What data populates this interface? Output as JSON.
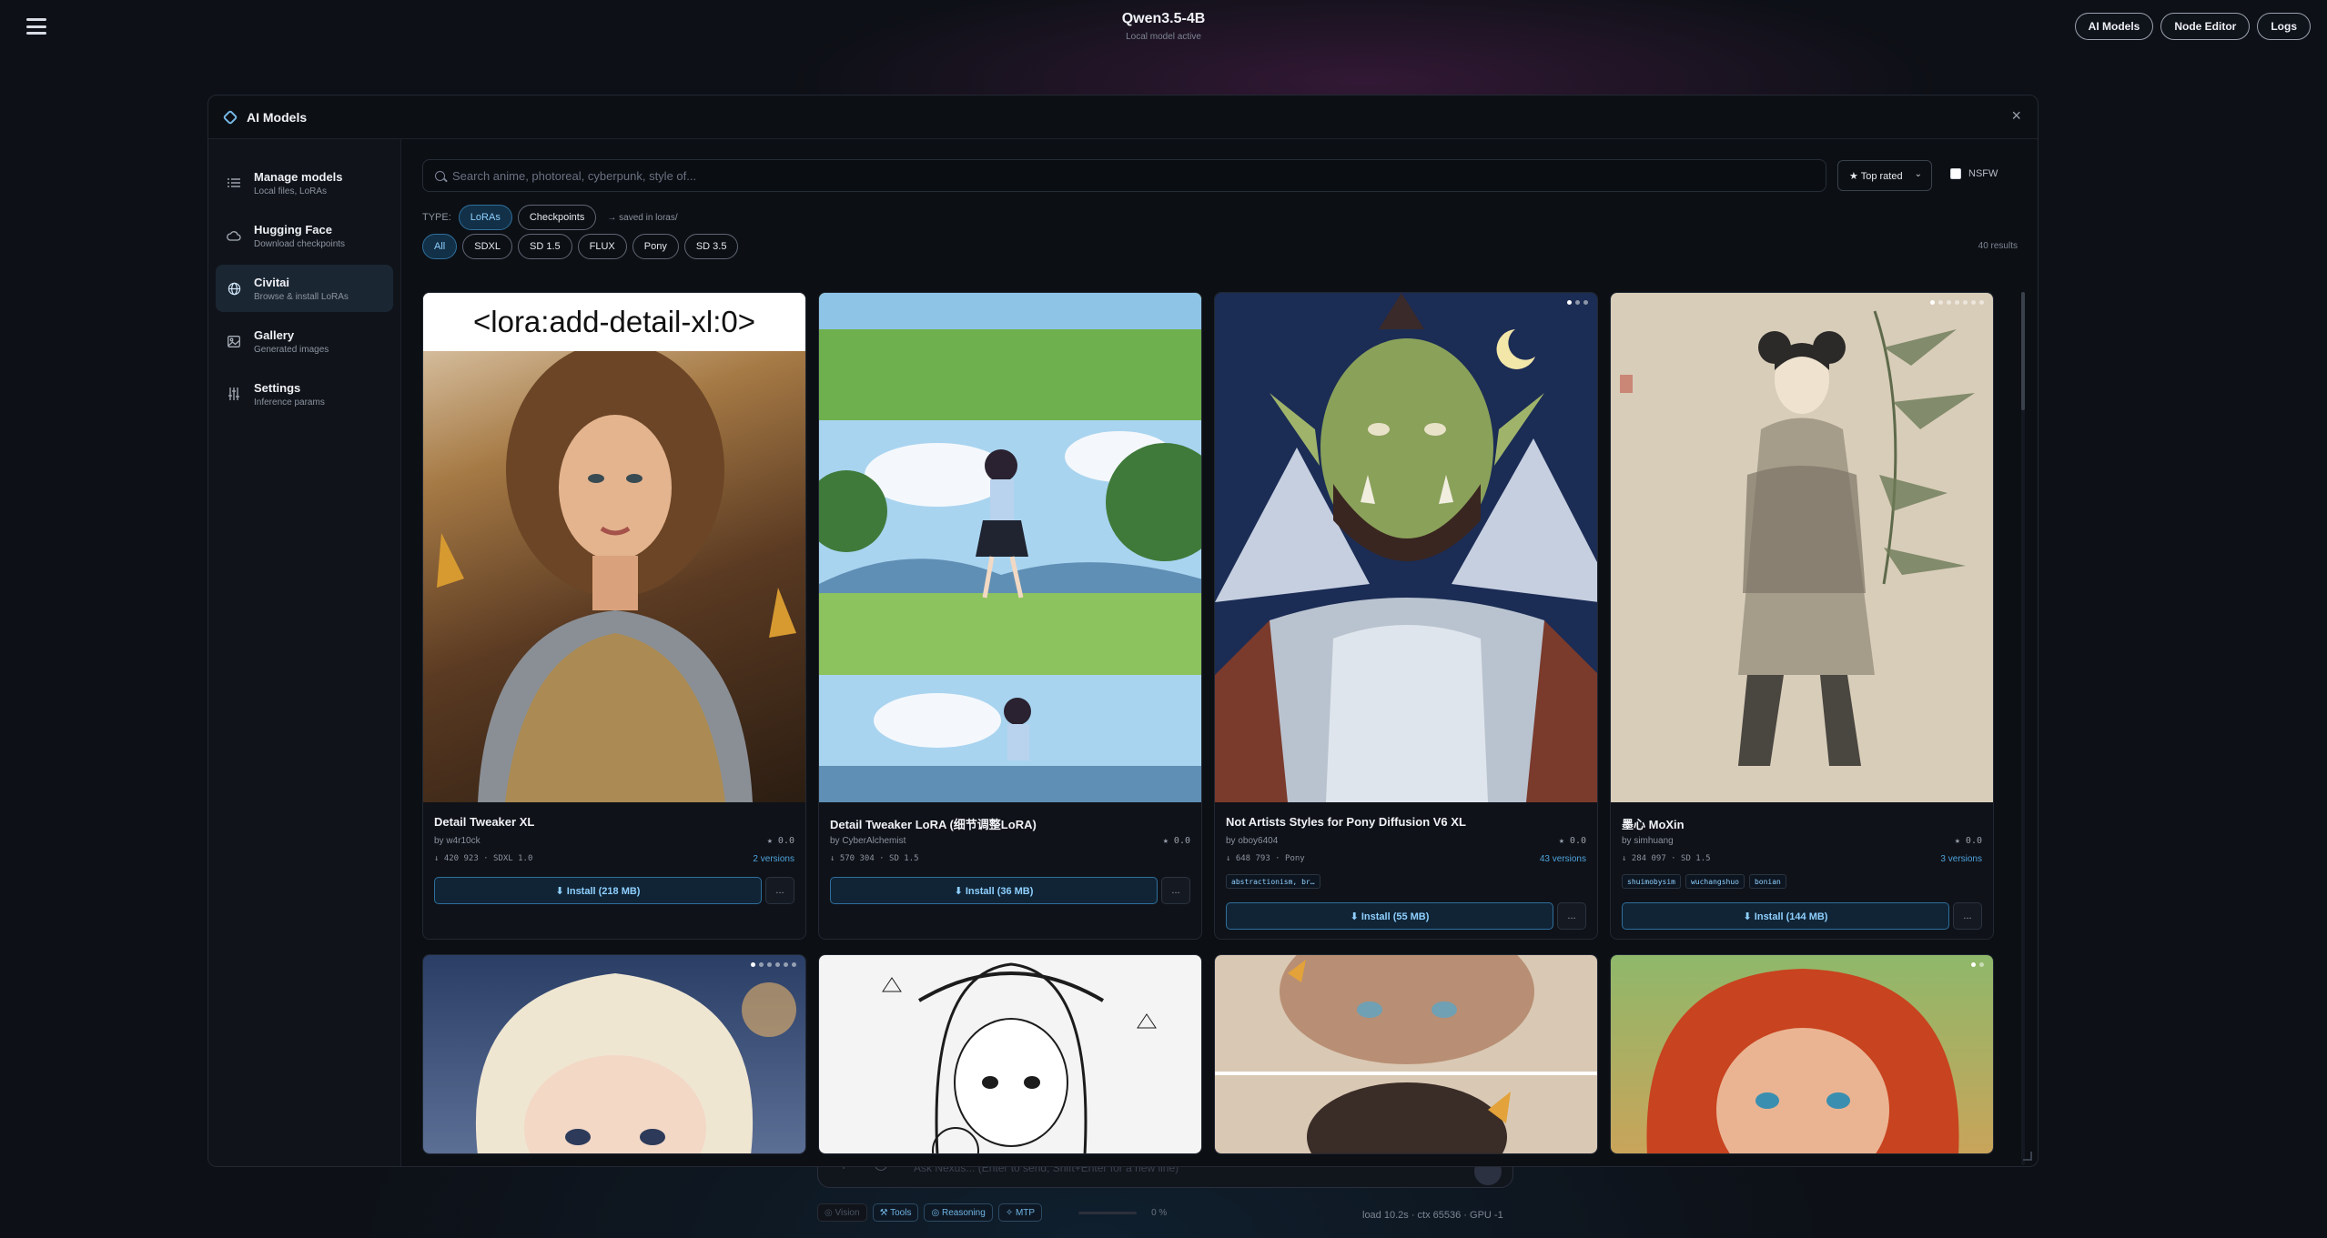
{
  "app": {
    "title": "Qwen3.5-4B",
    "subtitle": "Local model active"
  },
  "topnav": {
    "ai_models": "AI Models",
    "node_editor": "Node Editor",
    "logs": "Logs"
  },
  "modal": {
    "title": "AI Models",
    "close": "×"
  },
  "sidebar": {
    "items": [
      {
        "label": "Manage models",
        "sub": "Local files, LoRAs",
        "icon": "list-icon"
      },
      {
        "label": "Hugging Face",
        "sub": "Download checkpoints",
        "icon": "cloud-icon"
      },
      {
        "label": "Civitai",
        "sub": "Browse & install LoRAs",
        "icon": "globe-icon"
      },
      {
        "label": "Gallery",
        "sub": "Generated images",
        "icon": "image-icon"
      },
      {
        "label": "Settings",
        "sub": "Inference params",
        "icon": "sliders-icon"
      }
    ],
    "active": "Civitai"
  },
  "search": {
    "placeholder": "Search anime, photoreal, cyberpunk, style of..."
  },
  "sort": {
    "selected": "★ Top rated"
  },
  "nsfw": {
    "label": "NSFW",
    "checked": false
  },
  "type_filter": {
    "label": "TYPE:",
    "options": [
      "LoRAs",
      "Checkpoints"
    ],
    "active": "LoRAs",
    "note": "→ saved in loras/"
  },
  "base_filter": {
    "options": [
      "All",
      "SDXL",
      "SD 1.5",
      "FLUX",
      "Pony",
      "SD 3.5"
    ],
    "active": "All"
  },
  "results": {
    "count": "40 results"
  },
  "cards": [
    {
      "name": "Detail Tweaker XL",
      "author": "by w4r10ck",
      "rating": "★ 0.0",
      "stats": "↓ 420 923 · SDXL 1.0",
      "versions": "2 versions",
      "tags": [],
      "install": "⬇ Install (218 MB)",
      "more": "...",
      "overlay_text": "<lora:add-detail-xl:0>"
    },
    {
      "name": "Detail Tweaker LoRA (细节调整LoRA)",
      "author": "by CyberAlchemist",
      "rating": "★ 0.0",
      "stats": "↓ 570 304 · SD 1.5",
      "versions": "",
      "tags": [],
      "install": "⬇ Install (36 MB)",
      "more": "..."
    },
    {
      "name": "Not Artists Styles for Pony Diffusion V6 XL",
      "author": "by oboy6404",
      "rating": "★ 0.0",
      "stats": "↓ 648 793 · Pony",
      "versions": "43 versions",
      "tags": [
        "abstractionism, br…"
      ],
      "install": "⬇ Install (55 MB)",
      "more": "..."
    },
    {
      "name": "墨心 MoXin",
      "author": "by simhuang",
      "rating": "★ 0.0",
      "stats": "↓ 284 097 · SD 1.5",
      "versions": "3 versions",
      "tags": [
        "shuimobysim",
        "wuchangshuo",
        "bonian"
      ],
      "install": "⬇ Install (144 MB)",
      "more": "..."
    }
  ],
  "chat": {
    "placeholder": "Ask Nexus... (Enter to send, Shift+Enter for a new line)"
  },
  "bottom_chips": {
    "vision": "◎ Vision",
    "tools": "⚒ Tools",
    "reasoning": "◎ Reasoning",
    "mtp": "✧ MTP",
    "slider_value": "0 %"
  },
  "status": {
    "text": "load 10.2s · ctx 65536 · GPU -1"
  },
  "colors": {
    "accent": "#8fd0ff",
    "accent_border": "#2f6f9c",
    "background": "#0d1016",
    "panel": "#0c0f14"
  }
}
